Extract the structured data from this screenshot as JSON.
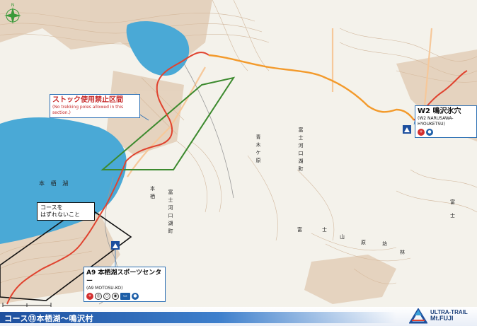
{
  "map": {
    "lake_label": "本 栖 湖",
    "town_vertical_1": "富士河口湖町",
    "town_vertical_2": "富士河口湖町",
    "forest_vertical": "青木ケ原",
    "plain_labels": [
      "富",
      "士",
      "山",
      "原",
      "本",
      "栖",
      "坊",
      "林",
      "富",
      "士"
    ]
  },
  "callouts": {
    "no_poles": {
      "jp": "ストック使用禁止区間",
      "en": "(No trekking poles allowed in this section.)"
    },
    "stay_on_course": {
      "line1": "コースを",
      "line2": "はずれないこと"
    }
  },
  "waypoints": {
    "w2": {
      "title": "W2  鳴沢氷穴",
      "sub": "(W2 NARUSAWA-HYOUKETSU)",
      "icons": [
        "aid",
        "water"
      ]
    },
    "a9": {
      "title": "A9  本栖湖スポーツセンター",
      "sub": "(A9 MOTOSU-KO)",
      "icons": [
        "aid",
        "food",
        "water",
        "toilet",
        "bus",
        "medic"
      ]
    }
  },
  "footer": {
    "title": "コース⑬本栖湖〜鳴沢村",
    "logo_line1": "ULTRA-TRAIL",
    "logo_line2": "Mt.FUJI"
  },
  "colors": {
    "route": "#e0432f",
    "route_orange": "#f39a2b",
    "water": "#4aa9d6",
    "no_pole_zone": "#3c8a2e",
    "stay_zone": "#111111",
    "brand": "#1d4f9e"
  },
  "icons": {
    "compass": "compass-rose-icon",
    "waypoint_marker": "mountain-marker-icon"
  }
}
